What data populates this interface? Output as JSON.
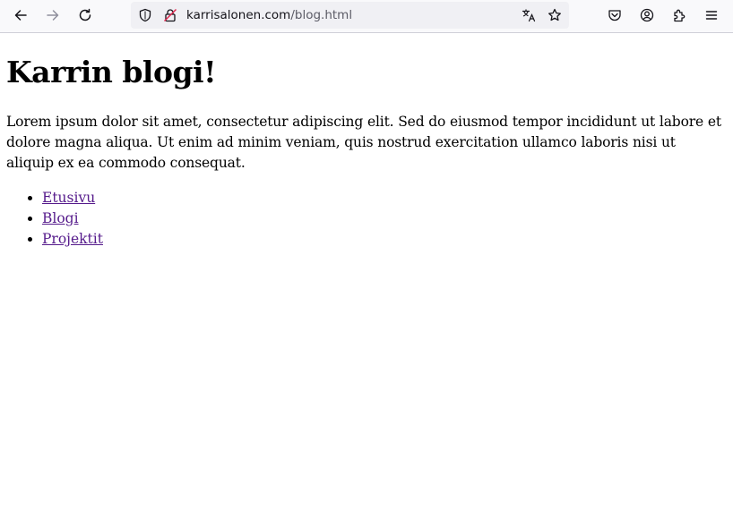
{
  "browser": {
    "url_host": "karrisalonen.com",
    "url_path": "/blog.html",
    "icons": {
      "back": "back-arrow-icon",
      "forward": "forward-arrow-icon",
      "reload": "reload-icon",
      "tracking_protection": "shield-icon",
      "connection": "insecure-lock-icon",
      "translate": "translate-icon",
      "bookmark": "star-icon",
      "pocket": "pocket-icon",
      "account": "account-icon",
      "extensions": "puzzle-piece-icon",
      "menu": "hamburger-menu-icon"
    }
  },
  "page": {
    "title": "Karrin blogi!",
    "intro": "Lorem ipsum dolor sit amet, consectetur adipiscing elit. Sed do eiusmod tempor incididunt ut labore et dolore magna aliqua. Ut enim ad minim veniam, quis nostrud exercitation ullamco laboris nisi ut aliquip ex ea commodo consequat.",
    "nav": [
      {
        "label": "Etusivu"
      },
      {
        "label": "Blogi"
      },
      {
        "label": "Projektit"
      }
    ],
    "link_color": "#551a8b"
  }
}
